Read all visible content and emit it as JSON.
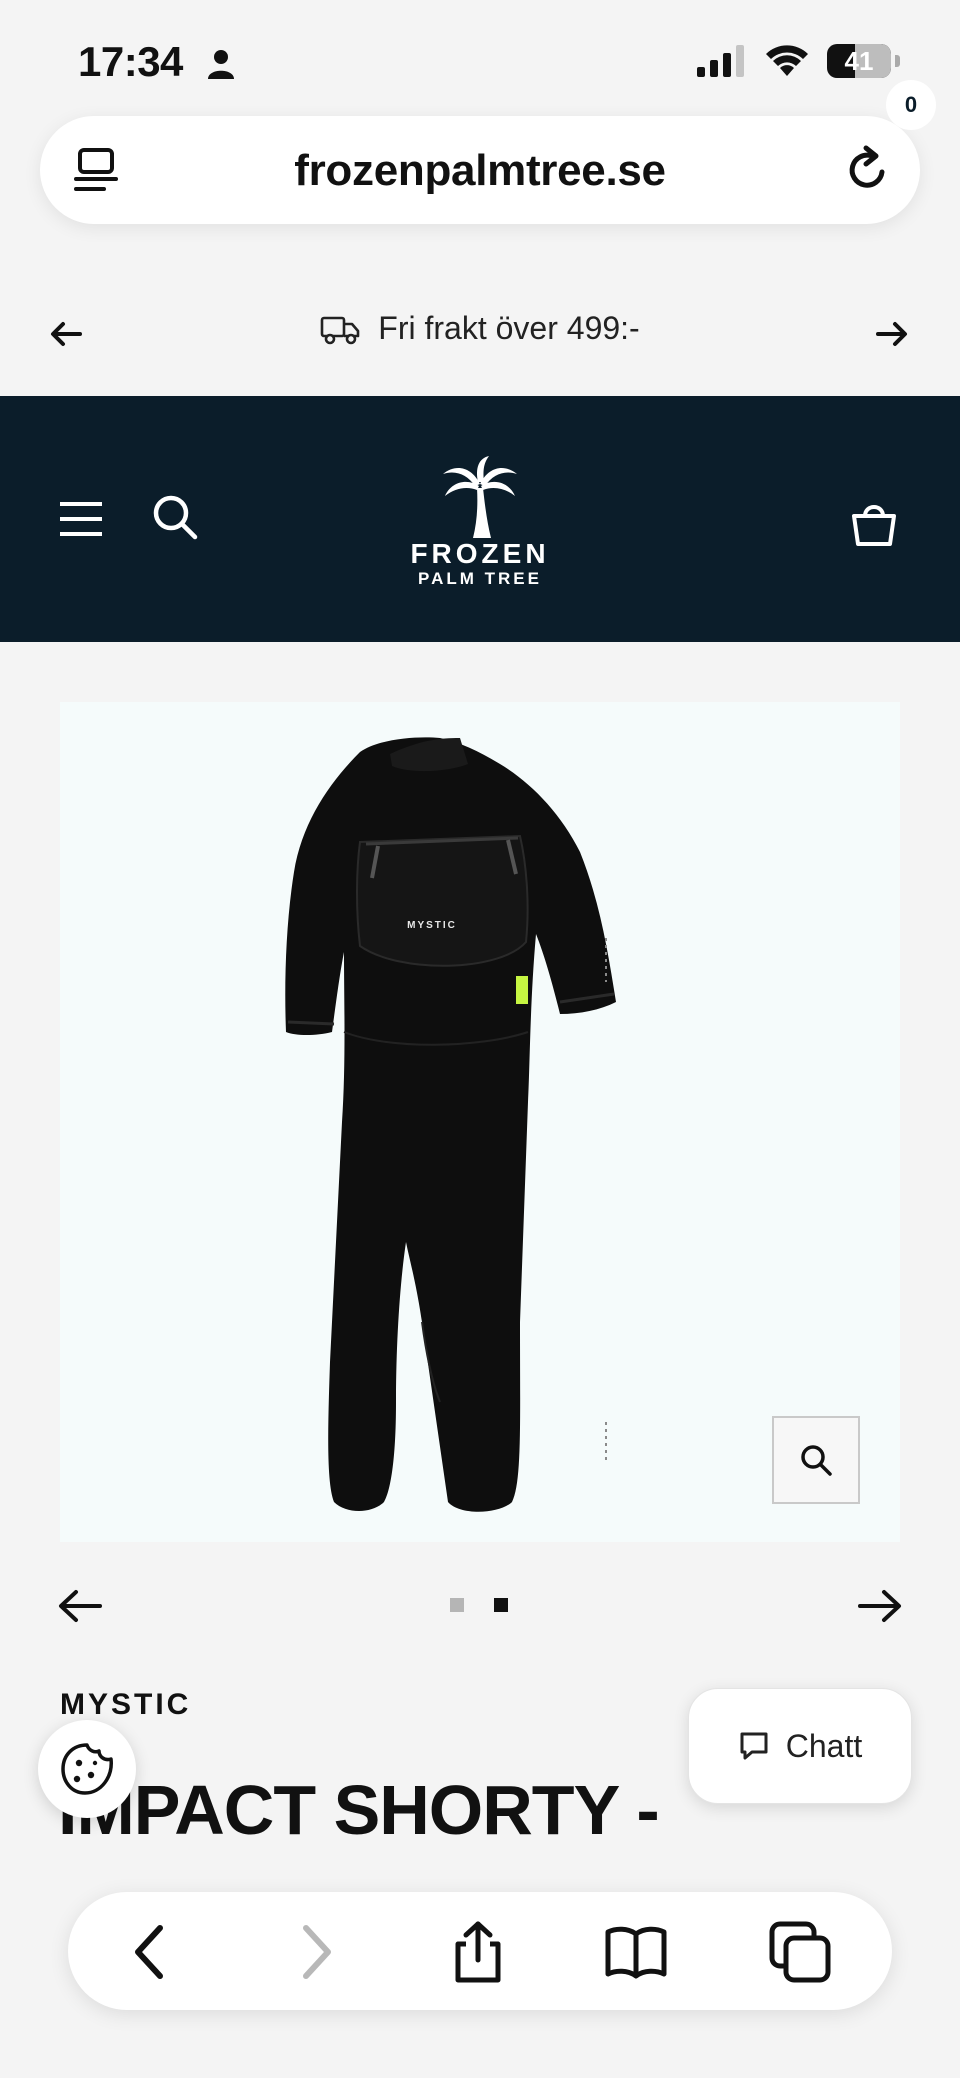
{
  "status": {
    "time": "17:34",
    "battery": "41"
  },
  "browser": {
    "url": "frozenpalmtree.se"
  },
  "announcement": {
    "text": "Fri frakt över 499:-"
  },
  "header": {
    "logo_line1": "FROZEN",
    "logo_line2": "PALM TREE",
    "cart_count": "0"
  },
  "gallery": {
    "image_brand_print": "MYSTIC",
    "slides": [
      {
        "active": false
      },
      {
        "active": true
      }
    ]
  },
  "product": {
    "brand": "MYSTIC",
    "title": "IMPACT SHORTY -"
  },
  "widgets": {
    "chat_label": "Chatt"
  },
  "colors": {
    "header_bg": "#0b1d2a",
    "image_bg": "#f5fbfb",
    "accent_lime": "#c6f542"
  },
  "icons": {
    "url_left": "reader-icon",
    "url_right": "reload-icon",
    "toolbar": [
      "back-icon",
      "forward-icon",
      "share-icon",
      "bookmarks-icon",
      "tabs-icon"
    ]
  }
}
